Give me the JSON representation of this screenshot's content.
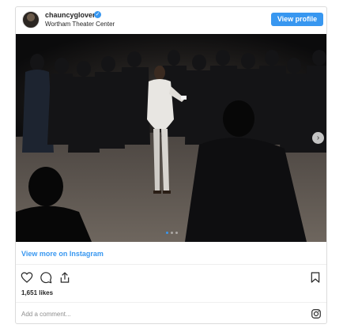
{
  "post": {
    "username": "chauncyglover",
    "verified_mark": "✓",
    "location": "Wortham Theater Center",
    "view_profile_label": "View profile",
    "next_arrow": "›",
    "carousel": {
      "count": 3,
      "active_index": 0
    }
  },
  "footer": {
    "view_more_label": "View more on Instagram",
    "likes": "1,651 likes",
    "comment_placeholder": "Add a comment..."
  },
  "icons": {
    "like": "heart-icon",
    "comment": "speech-bubble-icon",
    "share": "share-icon",
    "save": "bookmark-icon",
    "brand": "instagram-icon"
  },
  "colors": {
    "accent": "#3897f0",
    "text": "#262626",
    "muted": "#8e8e8e",
    "border": "#dbdbdb"
  }
}
